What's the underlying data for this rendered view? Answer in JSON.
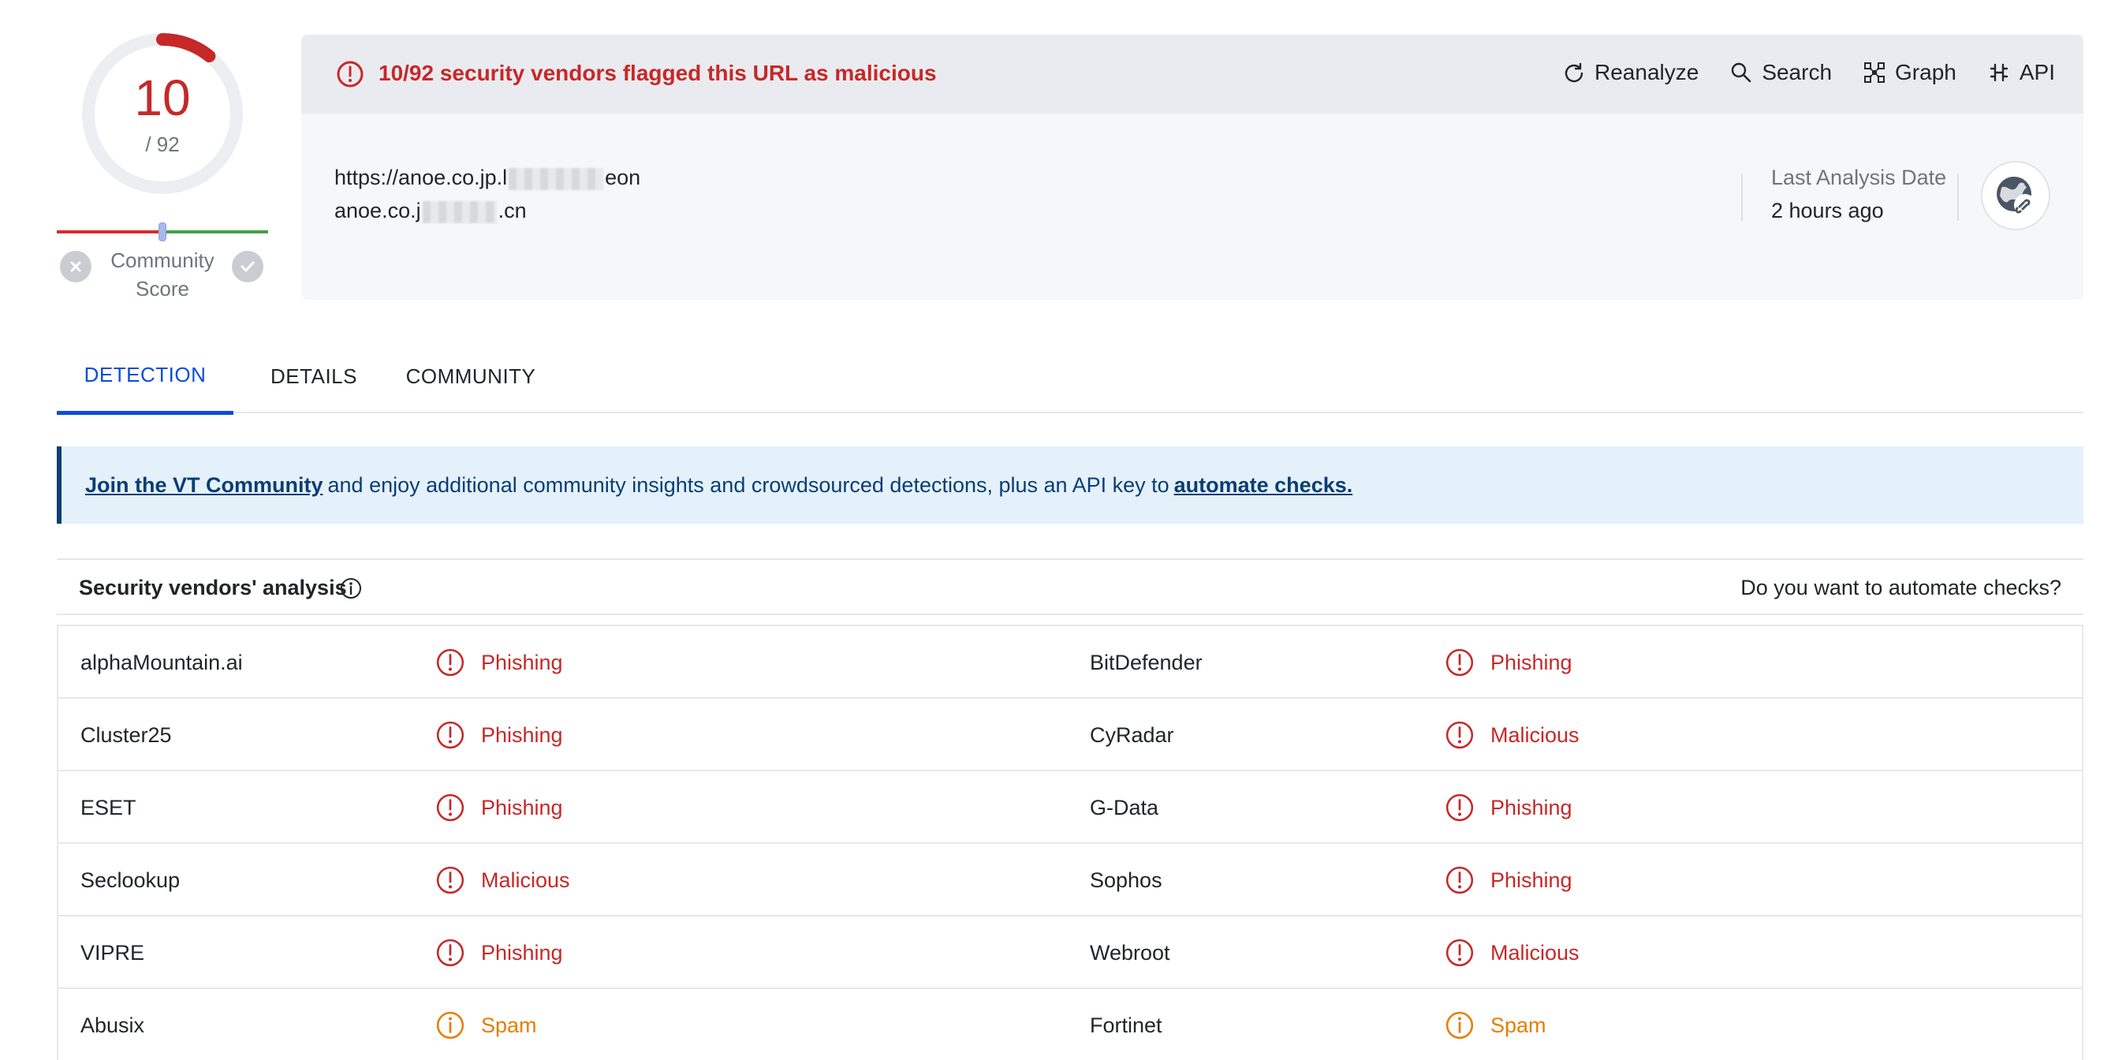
{
  "score": {
    "detections": "10",
    "total": "/ 92",
    "detection_fraction": 0.1087,
    "community_label": "Community Score",
    "community_position": 0.5
  },
  "alert": {
    "text": "10/92 security vendors flagged this URL as malicious",
    "icon": "alert-circle-icon",
    "color": "#c62828"
  },
  "actions": [
    {
      "label": "Reanalyze",
      "icon": "refresh-icon"
    },
    {
      "label": "Search",
      "icon": "search-icon"
    },
    {
      "label": "Graph",
      "icon": "graph-icon"
    },
    {
      "label": "API",
      "icon": "api-icon"
    }
  ],
  "target": {
    "url_prefix": "https://anoe.co.jp.l",
    "url_suffix": "eon",
    "domain_prefix": "anoe.co.j",
    "domain_suffix": ".cn"
  },
  "analysis": {
    "last_date_label": "Last Analysis Date",
    "last_date_value": "2 hours ago"
  },
  "tabs": [
    {
      "label": "DETECTION",
      "active": true
    },
    {
      "label": "DETAILS",
      "active": false
    },
    {
      "label": "COMMUNITY",
      "active": false
    }
  ],
  "banner": {
    "link1": "Join the VT Community",
    "middle": "and enjoy additional community insights and crowdsourced detections, plus an API key to",
    "link2": "automate checks."
  },
  "vendors_section": {
    "title": "Security vendors' analysis",
    "automate_prompt": "Do you want to automate checks?"
  },
  "vendors": [
    [
      {
        "name": "alphaMountain.ai",
        "result": "Phishing",
        "severity": "malicious"
      },
      {
        "name": "BitDefender",
        "result": "Phishing",
        "severity": "malicious"
      }
    ],
    [
      {
        "name": "Cluster25",
        "result": "Phishing",
        "severity": "malicious"
      },
      {
        "name": "CyRadar",
        "result": "Malicious",
        "severity": "malicious"
      }
    ],
    [
      {
        "name": "ESET",
        "result": "Phishing",
        "severity": "malicious"
      },
      {
        "name": "G-Data",
        "result": "Phishing",
        "severity": "malicious"
      }
    ],
    [
      {
        "name": "Seclookup",
        "result": "Malicious",
        "severity": "malicious"
      },
      {
        "name": "Sophos",
        "result": "Phishing",
        "severity": "malicious"
      }
    ],
    [
      {
        "name": "VIPRE",
        "result": "Phishing",
        "severity": "malicious"
      },
      {
        "name": "Webroot",
        "result": "Malicious",
        "severity": "malicious"
      }
    ],
    [
      {
        "name": "Abusix",
        "result": "Spam",
        "severity": "suspicious"
      },
      {
        "name": "Fortinet",
        "result": "Spam",
        "severity": "suspicious"
      }
    ]
  ],
  "colors": {
    "malicious": "#c62828",
    "suspicious": "#e67e00",
    "accent": "#0b4dd8",
    "banner_text": "#0b3d74"
  }
}
